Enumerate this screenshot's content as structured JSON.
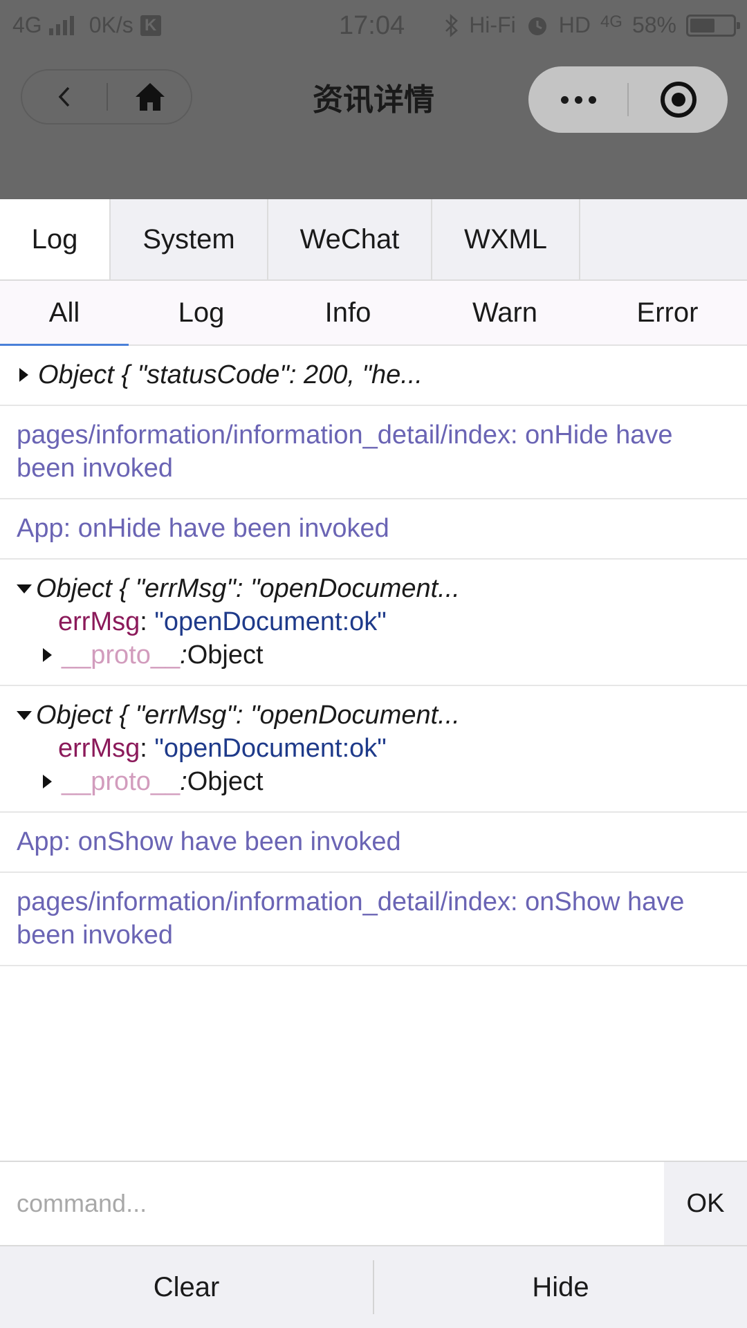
{
  "status_bar": {
    "network": "4G",
    "speed": "0K/s",
    "badge": "K",
    "time": "17:04",
    "hifi": "Hi-Fi",
    "hd": "HD",
    "hd_net": "4G",
    "battery_percent": "58%",
    "battery_level": 0.58
  },
  "title_bar": {
    "title": "资讯详情"
  },
  "main_tabs": [
    {
      "label": "Log",
      "active": true
    },
    {
      "label": "System",
      "active": false
    },
    {
      "label": "WeChat",
      "active": false
    },
    {
      "label": "WXML",
      "active": false
    }
  ],
  "sub_tabs": [
    {
      "label": "All",
      "active": true
    },
    {
      "label": "Log",
      "active": false
    },
    {
      "label": "Info",
      "active": false
    },
    {
      "label": "Warn",
      "active": false
    },
    {
      "label": "Error",
      "active": false
    }
  ],
  "logs": {
    "entry1": {
      "summary": "Object { \"statusCode\": 200, \"he..."
    },
    "entry2": {
      "text": "pages/information/information_detail/index: onHide have been invoked"
    },
    "entry3": {
      "text": "App: onHide have been invoked"
    },
    "entry4": {
      "summary": "Object { \"errMsg\": \"openDocument...",
      "prop_key": "errMsg",
      "prop_sep": ": ",
      "prop_value": "\"openDocument:ok\"",
      "proto_key": "__proto__",
      "proto_sep": ": ",
      "proto_value": "Object"
    },
    "entry5": {
      "summary": "Object { \"errMsg\": \"openDocument...",
      "prop_key": "errMsg",
      "prop_sep": ": ",
      "prop_value": "\"openDocument:ok\"",
      "proto_key": "__proto__",
      "proto_sep": ": ",
      "proto_value": "Object"
    },
    "entry6": {
      "text": "App: onShow have been invoked"
    },
    "entry7": {
      "text": "pages/information/information_detail/index: onShow have been invoked"
    }
  },
  "command": {
    "placeholder": "command...",
    "ok_label": "OK"
  },
  "bottom": {
    "clear_label": "Clear",
    "hide_label": "Hide"
  },
  "colors": {
    "message_text": "#6a64b4",
    "prop_key": "#8b1a5a",
    "prop_value": "#1e3a8a",
    "proto_key": "#d29cbd",
    "active_tab_underline": "#4a80d8",
    "overlay": "#686868"
  }
}
